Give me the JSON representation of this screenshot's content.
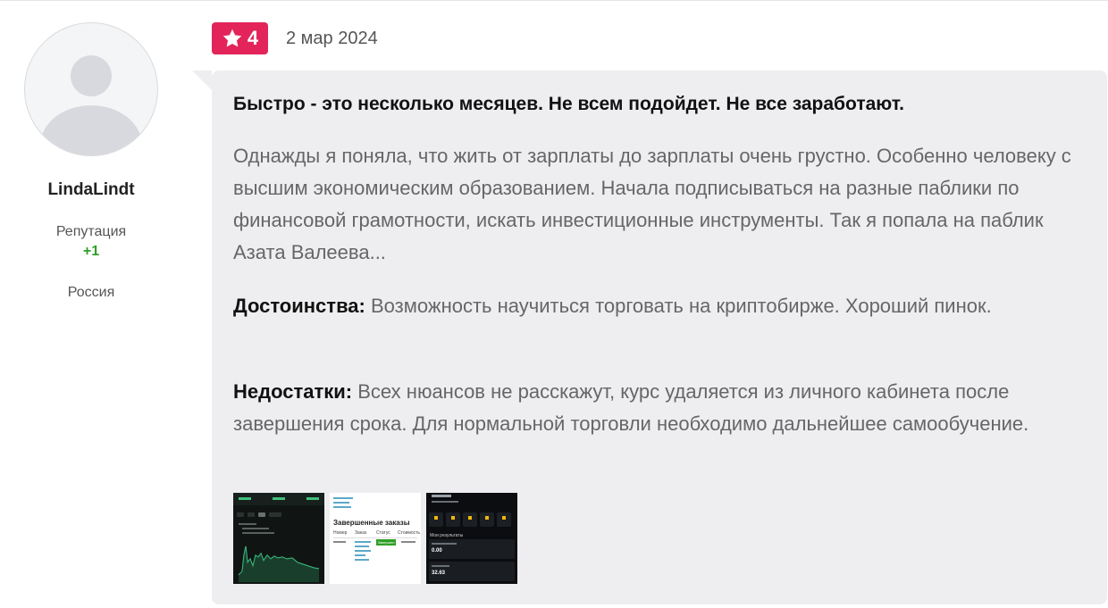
{
  "author": {
    "username": "LindaLindt",
    "reputation_label": "Репутация",
    "reputation_value": "+1",
    "country": "Россия"
  },
  "review": {
    "rating": "4",
    "date": "2 мар 2024",
    "title": "Быстро - это несколько месяцев. Не всем подойдет. Не все заработают.",
    "body": "Однажды я поняла, что жить от зарплаты до зарплаты очень грустно. Особенно человеку с высшим экономическим образованием. Начала подписываться на разные паблики по финансовой грамотности, искать инвестиционные инструменты. Так я попала на паблик Азата Валеева...",
    "pros_label": "Достоинства:",
    "pros": "Возможность научиться торговать на криптобирже. Хороший пинок.",
    "cons_label": "Недостатки:",
    "cons": "Всех нюансов не расскажут, курс удаляется из личного кабинета после завершения срока. Для нормальной торговли необходимо дальнейшее самообучение."
  },
  "thumbnails": {
    "second": {
      "heading": "Завершенные заказы",
      "col_number": "Номер",
      "col_order": "Заказ",
      "col_status": "Статус",
      "col_cost": "Стоимость",
      "status": "Завершен"
    },
    "third": {
      "section": "Мои результаты",
      "value_1": "0.00",
      "value_2": "32.63"
    }
  },
  "colors": {
    "accent": "#e3245a",
    "positive": "#2d9f26",
    "card_bg": "#eeeef1"
  }
}
